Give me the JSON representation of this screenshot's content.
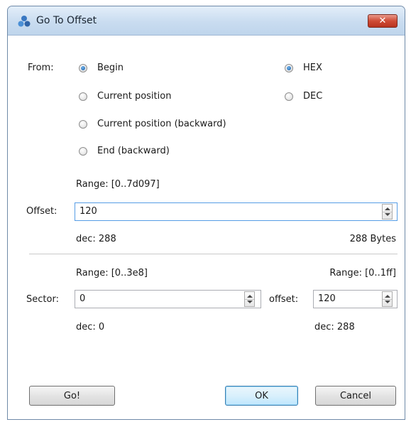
{
  "window": {
    "title": "Go To Offset",
    "close_label": "✕"
  },
  "from": {
    "label": "From:",
    "options": [
      {
        "label": "Begin",
        "checked": true
      },
      {
        "label": "Current position",
        "checked": false
      },
      {
        "label": "Current position (backward)",
        "checked": false
      },
      {
        "label": "End (backward)",
        "checked": false
      }
    ]
  },
  "base": {
    "options": [
      {
        "label": "HEX",
        "checked": true
      },
      {
        "label": "DEC",
        "checked": false
      }
    ]
  },
  "offset": {
    "range": "Range: [0..7d097]",
    "label": "Offset:",
    "value": "120",
    "dec": "dec: 288",
    "bytes": "288 Bytes"
  },
  "sector": {
    "range": "Range: [0..3e8]",
    "label": "Sector:",
    "value": "0",
    "dec": "dec: 0"
  },
  "sector_offset": {
    "range": "Range: [0..1ff]",
    "label": "offset:",
    "value": "120",
    "dec": "dec: 288"
  },
  "buttons": {
    "go": "Go!",
    "ok": "OK",
    "cancel": "Cancel"
  }
}
